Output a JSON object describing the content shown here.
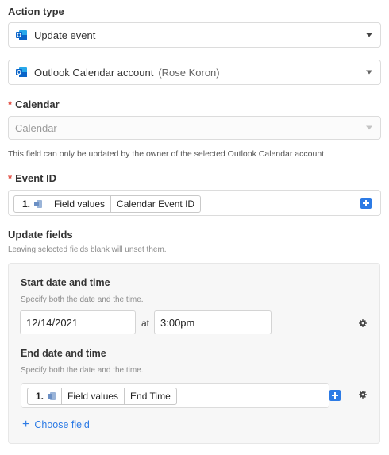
{
  "action_type": {
    "label": "Action type",
    "value": "Update event"
  },
  "account": {
    "name": "Outlook Calendar account",
    "owner": "(Rose Koron)"
  },
  "calendar": {
    "label": "Calendar",
    "required_mark": "*",
    "placeholder": "Calendar",
    "hint": "This field can only be updated by the owner of the selected Outlook Calendar account."
  },
  "event_id": {
    "label": "Event ID",
    "required_mark": "*",
    "token": {
      "step": "1.",
      "group": "Field values",
      "field": "Calendar Event ID"
    }
  },
  "update_fields": {
    "title": "Update fields",
    "hint": "Leaving selected fields blank will unset them.",
    "start": {
      "label": "Start date and time",
      "hint": "Specify both the date and the time.",
      "date": "12/14/2021",
      "at": "at",
      "time": "3:00pm"
    },
    "end": {
      "label": "End date and time",
      "hint": "Specify both the date and the time.",
      "token": {
        "step": "1.",
        "group": "Field values",
        "field": "End Time"
      }
    },
    "choose_field": "Choose field"
  },
  "colors": {
    "accent": "#2d7be5",
    "required": "#e0463a",
    "outlook_blue": "#0a64c8"
  }
}
